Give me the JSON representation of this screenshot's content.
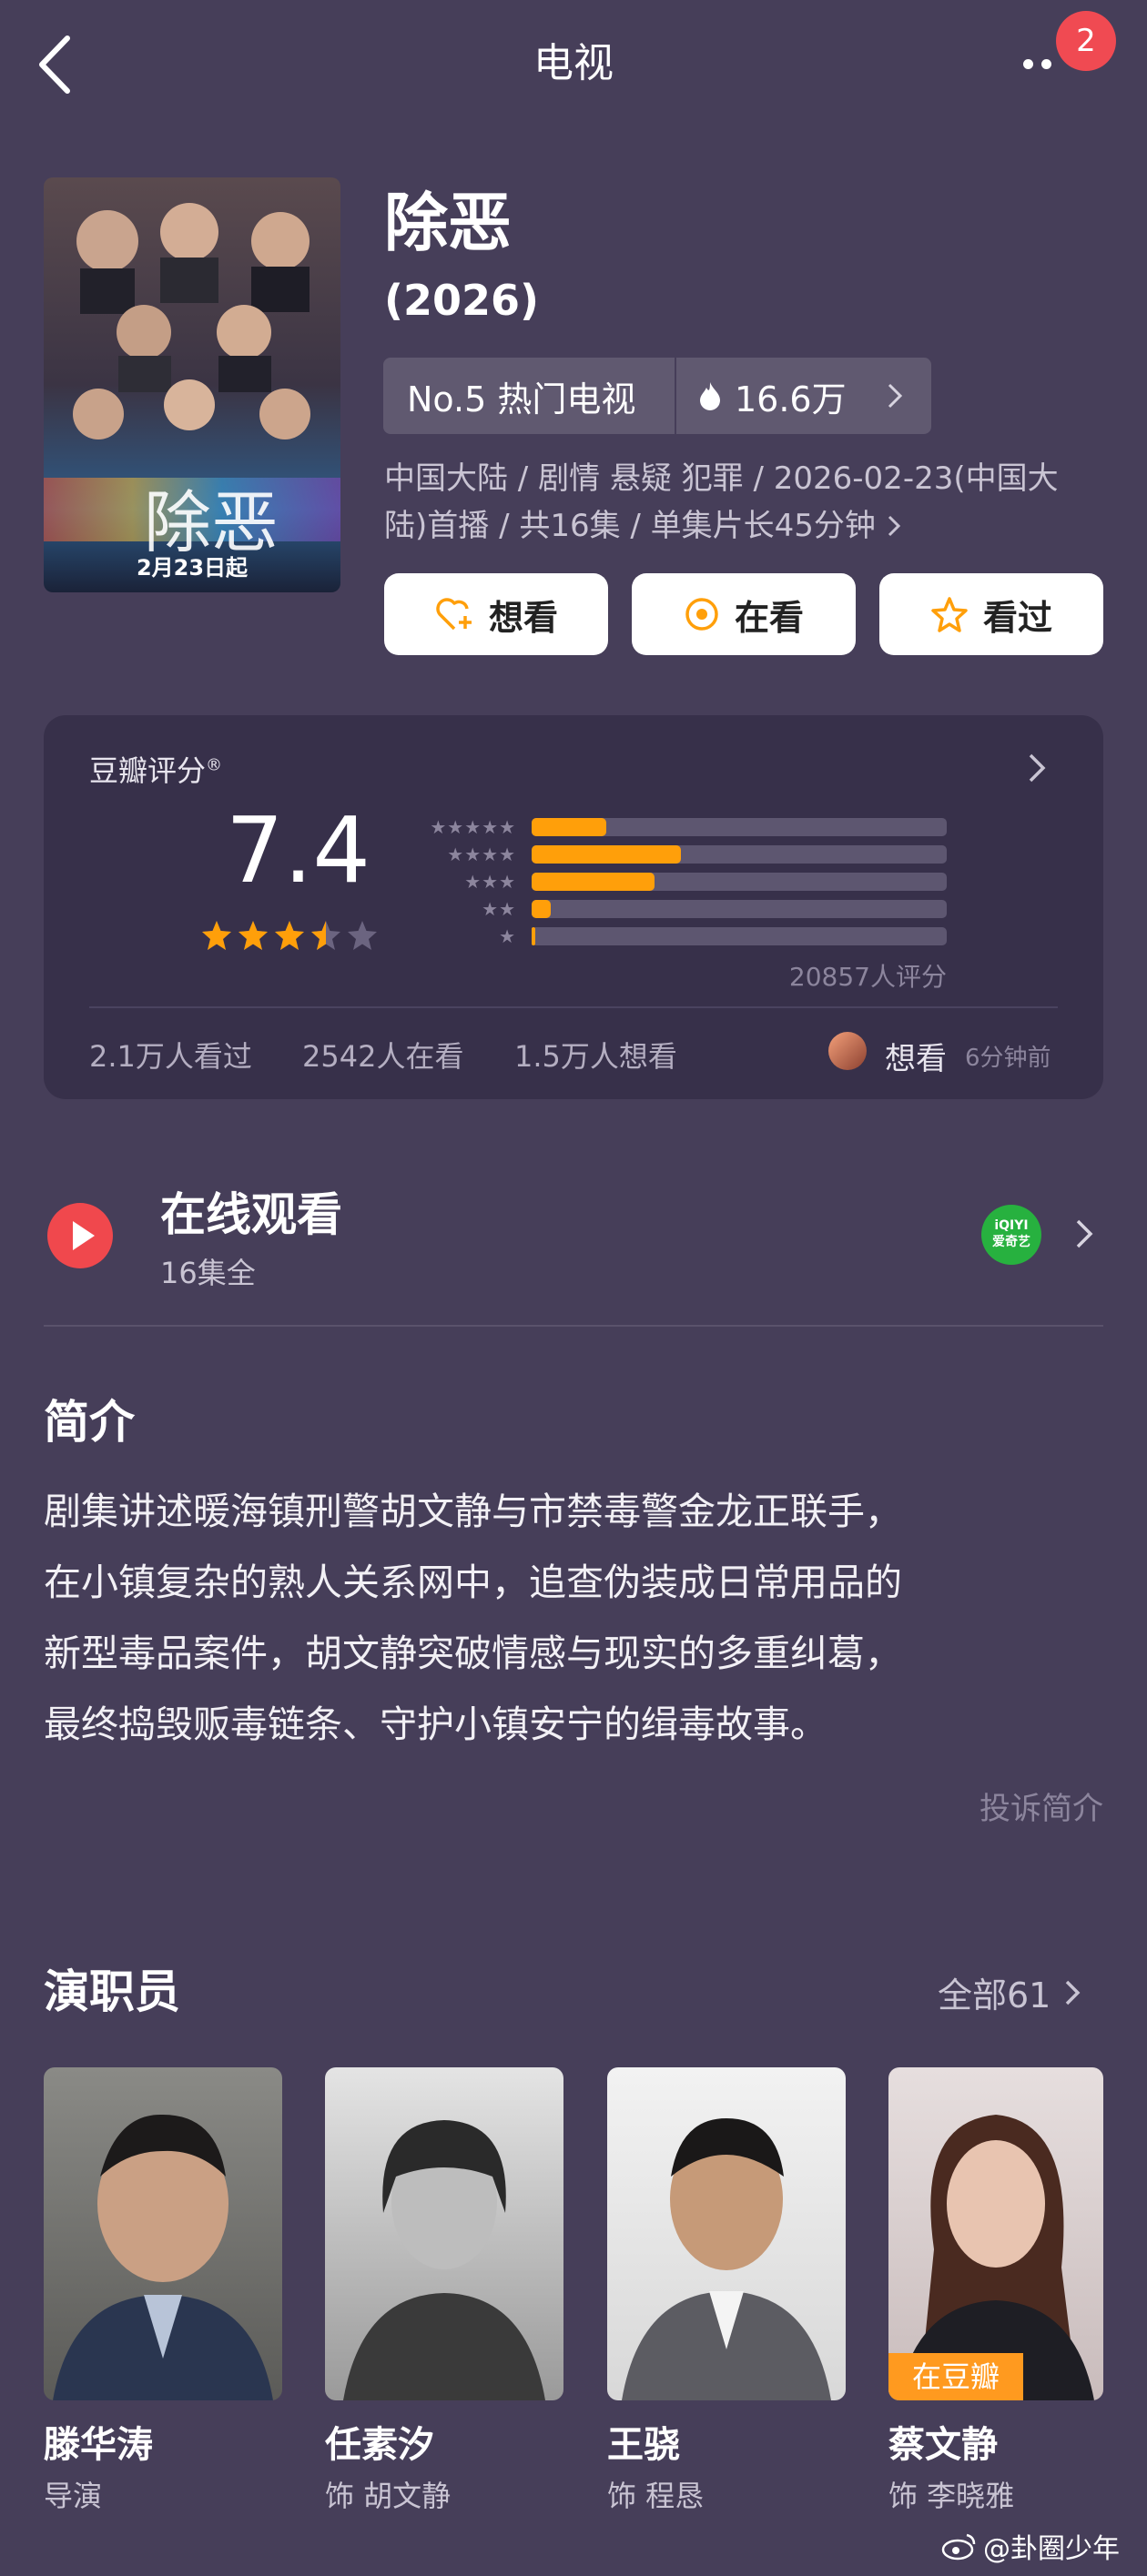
{
  "header": {
    "title": "电视",
    "badge_count": "2"
  },
  "show": {
    "title": "除恶",
    "year": "(2026)",
    "poster_logo": "除恶",
    "poster_caption": "2月23日起",
    "rank_label": "No.5 热门电视",
    "heat_value": "16.6万",
    "meta_line1": "中国大陆 / 剧情 悬疑 犯罪 / 2026-02-23(中国大",
    "meta_line2": "陆)首播 / 共16集 / 单集片长45分钟"
  },
  "actions": {
    "want": "想看",
    "watching": "在看",
    "watched": "看过"
  },
  "rating": {
    "label": "豆瓣评分",
    "score": "7.4",
    "score_value": 7.4,
    "star_fill": 3.5,
    "distribution_percent": [
      20,
      40,
      33,
      5,
      1
    ],
    "count_text": "20857人评分",
    "watched_text": "2.1万人看过",
    "watching_text": "2542人在看",
    "want_text": "1.5万人想看",
    "recent_action": "想看",
    "recent_time": "6分钟前"
  },
  "online": {
    "title": "在线观看",
    "subtitle": "16集全",
    "provider_line1": "iQIYI",
    "provider_line2": "爱奇艺"
  },
  "synopsis": {
    "title": "简介",
    "lines": [
      "剧集讲述暖海镇刑警胡文静与市禁毒警金龙正联手，",
      "在小镇复杂的熟人关系网中，追查伪装成日常用品的",
      "新型毒品案件，胡文静突破情感与现实的多重纠葛，",
      "最终捣毁贩毒链条、守护小镇安宁的缉毒故事。"
    ],
    "report": "投诉简介"
  },
  "cast": {
    "title": "演职员",
    "all_label": "全部61",
    "members": [
      {
        "name": "滕华涛",
        "role": "导演"
      },
      {
        "name": "任素汐",
        "role": "饰 胡文静"
      },
      {
        "name": "王骁",
        "role": "饰 程恳"
      },
      {
        "name": "蔡文静",
        "role": "饰 李晓雅",
        "tag": "在豆瓣"
      }
    ]
  },
  "watermark": "@卦圈少年",
  "colors": {
    "bg": "#463e59",
    "card": "#37304a",
    "accent": "#ff9f0a",
    "badge": "#f04a52"
  }
}
